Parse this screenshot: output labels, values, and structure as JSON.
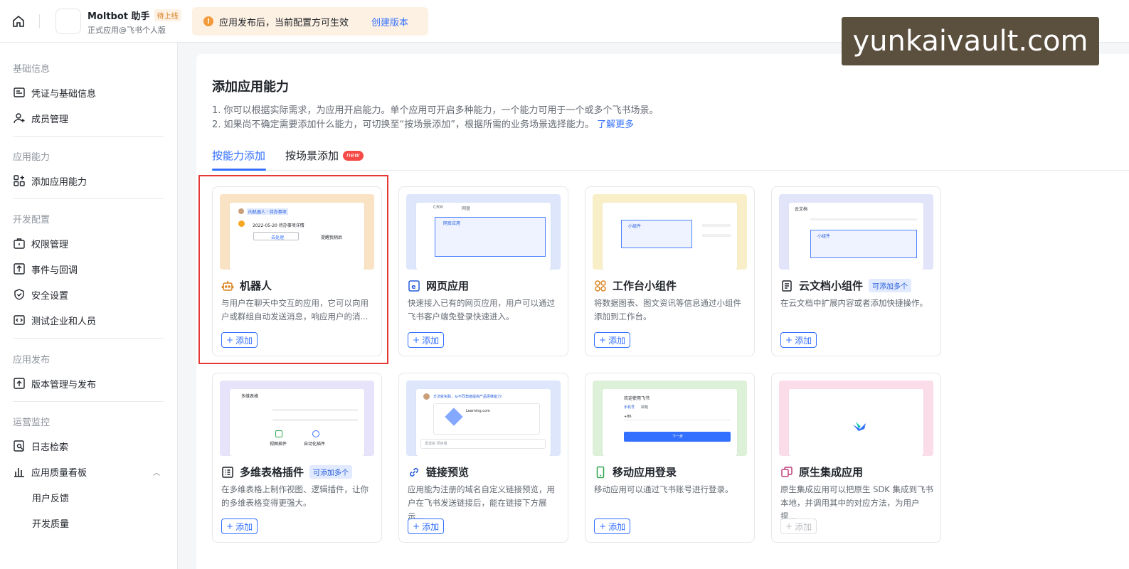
{
  "topbar": {
    "app_name": "Moltbot 助手",
    "status_badge": "待上线",
    "app_subtitle": "正式应用@飞书个人版",
    "notice_text": "应用发布后，当前配置方可生效",
    "notice_link": "创建版本",
    "watermark": "yunkaivault.com"
  },
  "sidebar": {
    "sections": [
      {
        "title": "基础信息",
        "items": [
          "凭证与基础信息",
          "成员管理"
        ]
      },
      {
        "title": "应用能力",
        "items": [
          "添加应用能力"
        ]
      },
      {
        "title": "开发配置",
        "items": [
          "权限管理",
          "事件与回调",
          "安全设置",
          "测试企业和人员"
        ]
      },
      {
        "title": "应用发布",
        "items": [
          "版本管理与发布"
        ]
      },
      {
        "title": "运营监控",
        "items": [
          "日志检索",
          "应用质量看板",
          "用户反馈",
          "开发质量"
        ]
      }
    ]
  },
  "main": {
    "title": "添加应用能力",
    "desc_line1": "1. 你可以根据实际需求，为应用开启能力。单个应用可开启多种能力，一个能力可用于一个或多个飞书场景。",
    "desc_line2": "2. 如果尚不确定需要添加什么能力，可切换至“按场景添加”，根据所需的业务场景选择能力。",
    "desc_link": "了解更多",
    "tabs": [
      "按能力添加",
      "按场景添加"
    ],
    "new_badge": "new",
    "add_label": "添加",
    "multi_badge": "可添加多个",
    "cards": [
      {
        "name": "机器人",
        "desc": "与用户在聊天中交互的应用，它可以向用户或群组自动发送消息，响应用户的消...",
        "icon": "robot-icon",
        "accent": "#f9e3c4"
      },
      {
        "name": "网页应用",
        "desc": "快速接入已有的网页应用，用户可以通过飞书客户端免登录快速进入。",
        "icon": "web-app-icon",
        "accent": "#dde6fb"
      },
      {
        "name": "工作台小组件",
        "desc": "将数据图表、图文资讯等信息通过小组件添加到工作台。",
        "icon": "widget-icon",
        "accent": "#f8efc8"
      },
      {
        "name": "云文档小组件",
        "desc": "在云文档中扩展内容或者添加快捷操作。",
        "icon": "doc-icon",
        "accent": "#e2e5fa"
      },
      {
        "name": "多维表格插件",
        "desc": "在多维表格上制作视图、逻辑插件，让你的多维表格变得更强大。",
        "icon": "bitable-icon",
        "accent": "#e6e3fa"
      },
      {
        "name": "链接预览",
        "desc": "应用能为注册的域名自定义链接预览，用户在飞书发送链接后，能在链接下方展示...",
        "icon": "link-icon",
        "accent": "#dde6fb"
      },
      {
        "name": "移动应用登录",
        "desc": "移动应用可以通过飞书账号进行登录。",
        "icon": "mobile-icon",
        "accent": "#dcf1d8"
      },
      {
        "name": "原生集成应用",
        "desc": "原生集成应用可以把原生 SDK 集成到飞书本地，并调用其中的对应方法，为用户提...",
        "icon": "native-app-icon",
        "accent": "#fbdde9"
      }
    ],
    "previews": {
      "bot_tag": "向机器人 · 待办事项",
      "bot_msg": "2022-05-20 待办事项详情",
      "bot_btn": "去处理",
      "bot_action": "提醒我稍后",
      "web_tab1": "CRM",
      "web_tab2": "网盘",
      "web_box": "网页应用",
      "widget_box": "小组件",
      "doc_title": "云文档",
      "doc_box": "小组件",
      "bitable_title": "多维表格",
      "bitable_a": "视图插件",
      "bitable_b": "自动化插件",
      "link_q": "方法就实践，从不同角度提高产品思维能力!",
      "link_url": "Learning.com",
      "link_input": "发送给 项目组",
      "login_title": "欢迎使用飞书",
      "login_tab1": "手机号",
      "login_tab2": "邮箱",
      "login_code": "+86",
      "login_btn": "下一步"
    }
  }
}
